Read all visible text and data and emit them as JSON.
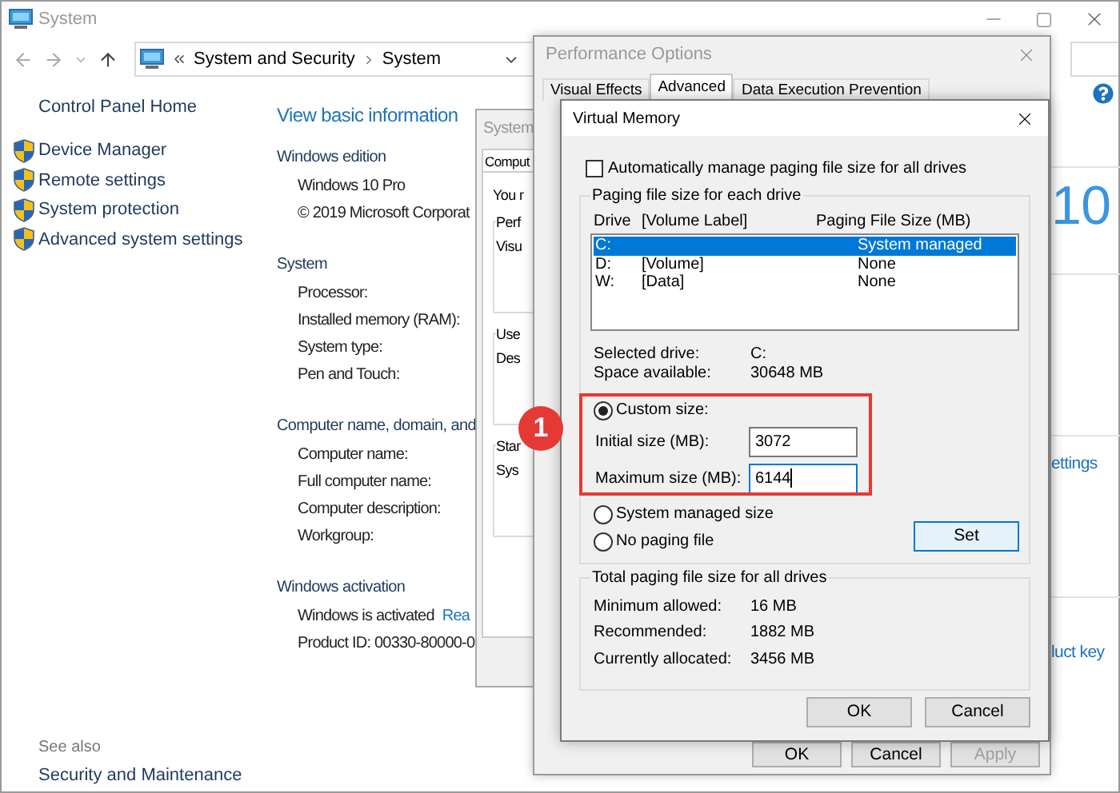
{
  "system_window": {
    "title": "System",
    "breadcrumb": [
      "System and Security",
      "System"
    ],
    "sidebar": {
      "home": "Control Panel Home",
      "links": [
        "Device Manager",
        "Remote settings",
        "System protection",
        "Advanced system settings"
      ],
      "see_also": "See also",
      "see_also_links": [
        "Security and Maintenance"
      ]
    },
    "heading": "View basic information",
    "sections": [
      {
        "title": "Windows edition",
        "logo": "10",
        "rows": [
          {
            "label": "Windows 10 Pro"
          },
          {
            "label": "© 2019 Microsoft Corporat"
          }
        ]
      },
      {
        "title": "System",
        "rows": [
          {
            "label": "Processor:"
          },
          {
            "label": "Installed memory (RAM):"
          },
          {
            "label": "System type:"
          },
          {
            "label": "Pen and Touch:"
          }
        ]
      },
      {
        "title": "Computer name, domain, and",
        "rows": [
          {
            "label": "Computer name:",
            "side_link": "ettings"
          },
          {
            "label": "Full computer name:"
          },
          {
            "label": "Computer description:"
          },
          {
            "label": "Workgroup:"
          }
        ]
      },
      {
        "title": "Windows activation",
        "rows": [
          {
            "label": "Windows is activated",
            "link": "Rea"
          },
          {
            "label": "Product ID: 00330-80000-0",
            "side_link": "luct key"
          }
        ]
      }
    ]
  },
  "system_properties": {
    "title": "System",
    "tab": "Comput",
    "intro": "You r",
    "groups": [
      {
        "title": "Perf",
        "text": "Visu"
      },
      {
        "title": "Use",
        "text": "Des"
      },
      {
        "title": "Star",
        "text": "Sys"
      }
    ]
  },
  "performance_options": {
    "title": "Performance Options",
    "tabs": [
      {
        "label": "Visual Effects",
        "selected": false
      },
      {
        "label": "Advanced",
        "selected": true
      },
      {
        "label": "Data Execution Prevention",
        "selected": false
      }
    ],
    "buttons": [
      {
        "label": "OK",
        "disabled": false
      },
      {
        "label": "Cancel",
        "disabled": false
      },
      {
        "label": "Apply",
        "disabled": true
      }
    ]
  },
  "virtual_memory": {
    "title": "Virtual Memory",
    "auto_manage": {
      "label": "Automatically manage paging file size for all drives",
      "checked": false
    },
    "drive_group": {
      "title": "Paging file size for each drive",
      "columns": [
        "Drive",
        "[Volume Label]",
        "Paging File Size (MB)"
      ],
      "rows": [
        {
          "drive": "C:",
          "size": "System managed",
          "selected": true
        },
        {
          "drive": "D:",
          "label": "[Volume]",
          "size": "None",
          "selected": false
        },
        {
          "drive": "W:",
          "label": "[Data]",
          "size": "None",
          "selected": false
        }
      ],
      "info": [
        {
          "label": "Selected drive:",
          "value": "C:"
        },
        {
          "label": "Space available:",
          "value": "30648 MB"
        }
      ],
      "size_options": [
        {
          "kind": "custom",
          "label": "Custom size:",
          "selected": true,
          "fields": [
            {
              "label": "Initial size (MB):",
              "value": "3072",
              "focused": false
            },
            {
              "label": "Maximum size (MB):",
              "value": "6144",
              "focused": true
            }
          ]
        },
        {
          "kind": "plain",
          "label": "System managed size",
          "selected": false
        },
        {
          "kind": "plain",
          "label": "No paging file",
          "selected": false
        }
      ],
      "set_button": "Set"
    },
    "totals": {
      "title": "Total paging file size for all drives",
      "rows": [
        {
          "label": "Minimum allowed:",
          "value": "16 MB"
        },
        {
          "label": "Recommended:",
          "value": "1882 MB"
        },
        {
          "label": "Currently allocated:",
          "value": "3456 MB"
        }
      ]
    },
    "buttons": [
      "OK",
      "Cancel"
    ]
  },
  "callout": {
    "number": "1"
  }
}
